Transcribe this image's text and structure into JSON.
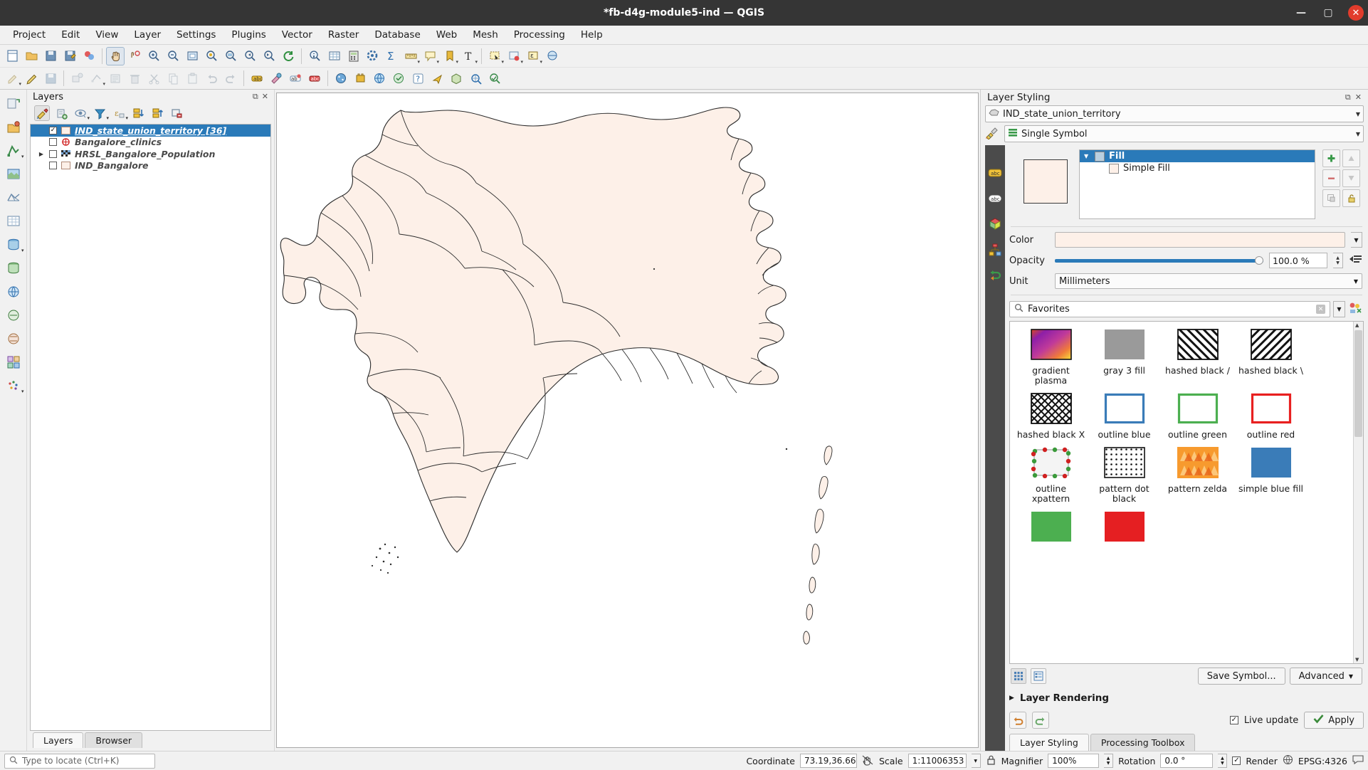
{
  "window": {
    "title": "*fb-d4g-module5-ind — QGIS",
    "minimize": "—",
    "maximize": "▢",
    "close": "✕"
  },
  "menubar": [
    {
      "label": "Project"
    },
    {
      "label": "Edit"
    },
    {
      "label": "View"
    },
    {
      "label": "Layer"
    },
    {
      "label": "Settings"
    },
    {
      "label": "Plugins"
    },
    {
      "label": "Vector"
    },
    {
      "label": "Raster"
    },
    {
      "label": "Database"
    },
    {
      "label": "Web"
    },
    {
      "label": "Mesh"
    },
    {
      "label": "Processing"
    },
    {
      "label": "Help"
    }
  ],
  "layers_panel": {
    "title": "Layers",
    "toolbar_icons": [
      "open-layer-styling-panel-icon",
      "add-group-icon",
      "manage-map-themes-icon",
      "filter-legend-icon",
      "expression-filter-icon",
      "expand-all-icon",
      "collapse-all-icon",
      "remove-layer-icon"
    ],
    "items": [
      {
        "name": "IND_state_union_territory [36]",
        "checked": true,
        "selected": true,
        "symbol": "polygon-swatch",
        "expandable": false
      },
      {
        "name": "Bangalore_clinics",
        "checked": false,
        "selected": false,
        "symbol": "point-marker",
        "expandable": false
      },
      {
        "name": "HRSL_Bangalore_Population",
        "checked": false,
        "selected": false,
        "symbol": "raster-swatch",
        "expandable": true
      },
      {
        "name": "IND_Bangalore",
        "checked": false,
        "selected": false,
        "symbol": "polygon-swatch",
        "expandable": false
      }
    ],
    "tabs": [
      {
        "label": "Layers",
        "active": true
      },
      {
        "label": "Browser",
        "active": false
      }
    ]
  },
  "styling": {
    "title": "Layer Styling",
    "layer_combo": "IND_state_union_territory",
    "renderer_combo": "Single Symbol",
    "symbol_tree": [
      {
        "label": "Fill",
        "selected": true,
        "indent": 0
      },
      {
        "label": "Simple Fill",
        "selected": false,
        "indent": 1
      }
    ],
    "properties": {
      "color_label": "Color",
      "color_value": "#fdf0e8",
      "opacity_label": "Opacity",
      "opacity_value": "100.0 %",
      "opacity_percent": 100,
      "unit_label": "Unit",
      "unit_value": "Millimeters"
    },
    "search_placeholder": "Favorites",
    "search_value": "Favorites",
    "gallery": [
      {
        "label": "gradient plasma",
        "type": "gradient"
      },
      {
        "label": "gray 3 fill",
        "type": "solid",
        "color": "#9a9a9a"
      },
      {
        "label": "hashed black /",
        "type": "hatch-fwd"
      },
      {
        "label": "hashed black \\",
        "type": "hatch-back"
      },
      {
        "label": "hashed black X",
        "type": "hatch-cross"
      },
      {
        "label": "outline blue",
        "type": "outline",
        "color": "#3a7cb8"
      },
      {
        "label": "outline green",
        "type": "outline",
        "color": "#4caf50"
      },
      {
        "label": "outline red",
        "type": "outline",
        "color": "#e82020"
      },
      {
        "label": "outline xpattern",
        "type": "xpattern"
      },
      {
        "label": "pattern dot black",
        "type": "dots"
      },
      {
        "label": "pattern zelda",
        "type": "zelda"
      },
      {
        "label": "simple blue fill",
        "type": "solid",
        "color": "#3a7cb8"
      },
      {
        "label": "",
        "type": "solid",
        "color": "#4caf50"
      },
      {
        "label": "",
        "type": "solid",
        "color": "#e51f22"
      }
    ],
    "save_symbol_label": "Save Symbol...",
    "advanced_label": "Advanced",
    "layer_rendering_label": "Layer Rendering",
    "live_update_label": "Live update",
    "live_update_checked": true,
    "apply_label": "Apply",
    "tabs": [
      {
        "label": "Layer Styling",
        "active": true
      },
      {
        "label": "Processing Toolbox",
        "active": false
      }
    ]
  },
  "statusbar": {
    "locate_placeholder": "Type to locate (Ctrl+K)",
    "coordinate_label": "Coordinate",
    "coordinate_value": "73.19,36.66",
    "scale_label": "Scale",
    "scale_value": "1:11006353",
    "magnifier_label": "Magnifier",
    "magnifier_value": "100%",
    "rotation_label": "Rotation",
    "rotation_value": "0.0 °",
    "render_label": "Render",
    "render_checked": true,
    "crs_label": "EPSG:4326"
  },
  "colors": {
    "selection_blue": "#2a7ab9",
    "titlebar": "#353535",
    "chrome": "#f1f1f1",
    "map_fill": "#fdf0e8",
    "map_stroke": "#2b2b2b"
  }
}
